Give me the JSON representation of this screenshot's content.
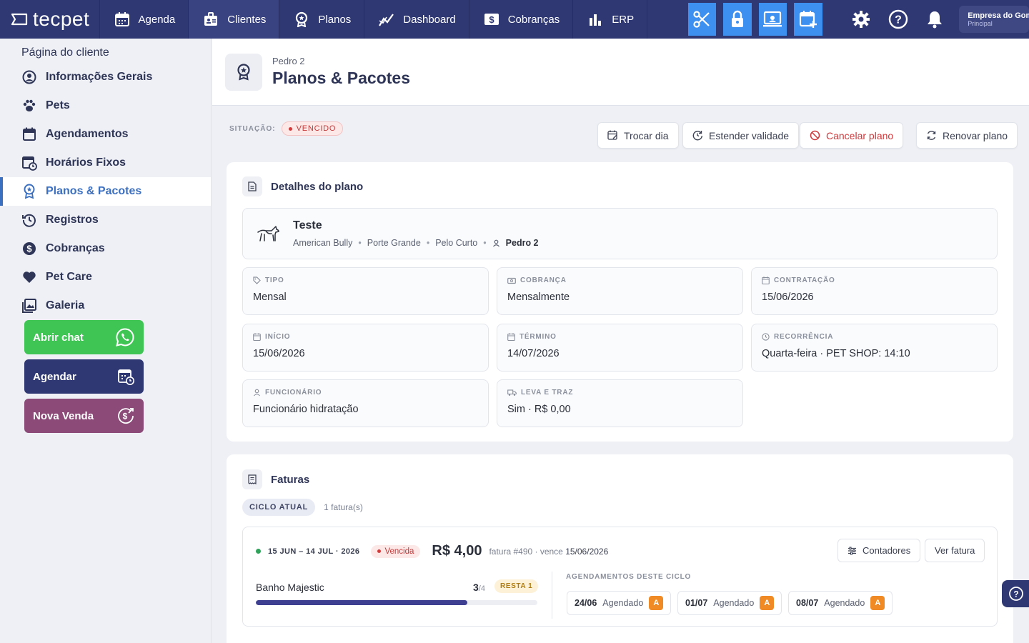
{
  "brand": {
    "logo_text": "tecpet"
  },
  "topnav": {
    "items": [
      {
        "label": "Agenda",
        "icon": "calendar-icon"
      },
      {
        "label": "Clientes",
        "icon": "clients-icon"
      },
      {
        "label": "Planos",
        "icon": "award-icon"
      },
      {
        "label": "Dashboard",
        "icon": "chart-line-icon"
      },
      {
        "label": "Cobranças",
        "icon": "dollar-box-icon"
      },
      {
        "label": "ERP",
        "icon": "bar-chart-icon"
      }
    ],
    "tools": [
      "scissors-icon",
      "lock-icon",
      "monitor-icon",
      "calendar-add-icon"
    ],
    "company_name": "Empresa do Gomes",
    "company_sub": "Principal",
    "accent": "#3d8ff0",
    "bg": "#2f3873"
  },
  "sidebar": {
    "title": "Página do cliente",
    "items": [
      {
        "label": "Informações Gerais",
        "icon": "user-circle-icon"
      },
      {
        "label": "Pets",
        "icon": "paw-icon"
      },
      {
        "label": "Agendamentos",
        "icon": "calendar-icon"
      },
      {
        "label": "Horários Fixos",
        "icon": "calendar-clock-icon"
      },
      {
        "label": "Planos & Pacotes",
        "icon": "award-icon",
        "active": true
      },
      {
        "label": "Registros",
        "icon": "history-icon"
      },
      {
        "label": "Cobranças",
        "icon": "dollar-circle-icon"
      },
      {
        "label": "Pet Care",
        "icon": "heart-icon"
      },
      {
        "label": "Galeria",
        "icon": "gallery-icon"
      }
    ],
    "buttons": [
      {
        "label": "Abrir chat",
        "color": "#3fc553",
        "icon": "whatsapp-icon"
      },
      {
        "label": "Agendar",
        "color": "#2f3873",
        "icon": "calendar-clock-icon"
      },
      {
        "label": "Nova Venda",
        "color": "#8b4a78",
        "icon": "sale-icon"
      }
    ]
  },
  "header": {
    "subtitle": "Pedro 2",
    "title": "Planos & Pacotes"
  },
  "status": {
    "label": "SITUAÇÃO:",
    "value": "VENCIDO"
  },
  "actions": {
    "trocar_dia": "Trocar dia",
    "estender": "Estender validade",
    "cancelar": "Cancelar plano",
    "renovar": "Renovar plano"
  },
  "details": {
    "title": "Detalhes do plano",
    "plan_name": "Teste",
    "breed": "American Bully",
    "size": "Porte Grande",
    "coat": "Pelo Curto",
    "owner": "Pedro 2",
    "fields": {
      "tipo_label": "TIPO",
      "tipo": "Mensal",
      "cobranca_label": "COBRANÇA",
      "cobranca": "Mensalmente",
      "contratacao_label": "CONTRATAÇÃO",
      "contratacao": "15/06/2026",
      "inicio_label": "INÍCIO",
      "inicio": "15/06/2026",
      "termino_label": "TÉRMINO",
      "termino": "14/07/2026",
      "recorrencia_label": "RECORRÊNCIA",
      "recorrencia": "Quarta-feira · PET SHOP: 14:10",
      "funcionario_label": "FUNCIONÁRIO",
      "funcionario": "Funcionário hidratação",
      "leva_label": "LEVA E TRAZ",
      "leva": "Sim · R$ 0,00"
    }
  },
  "invoices": {
    "title": "Faturas",
    "cycle_pill": "CICLO ATUAL",
    "count": "1 fatura(s)",
    "invoice": {
      "period": "15 JUN – 14 JUL · 2026",
      "status": "Vencida",
      "amount": "R$ 4,00",
      "number": "fatura #490 · vence",
      "due": "15/06/2026",
      "contadores": "Contadores",
      "ver_fatura": "Ver fatura",
      "service": "Banho Majestic",
      "used": "3",
      "total": "/4",
      "remaining": "RESTA 1",
      "progress": 0.75,
      "schedule_label": "AGENDAMENTOS DESTE CICLO",
      "appointments": [
        {
          "date": "24/06",
          "status": "Agendado",
          "tag": "A"
        },
        {
          "date": "01/07",
          "status": "Agendado",
          "tag": "A"
        },
        {
          "date": "08/07",
          "status": "Agendado",
          "tag": "A"
        }
      ]
    }
  }
}
